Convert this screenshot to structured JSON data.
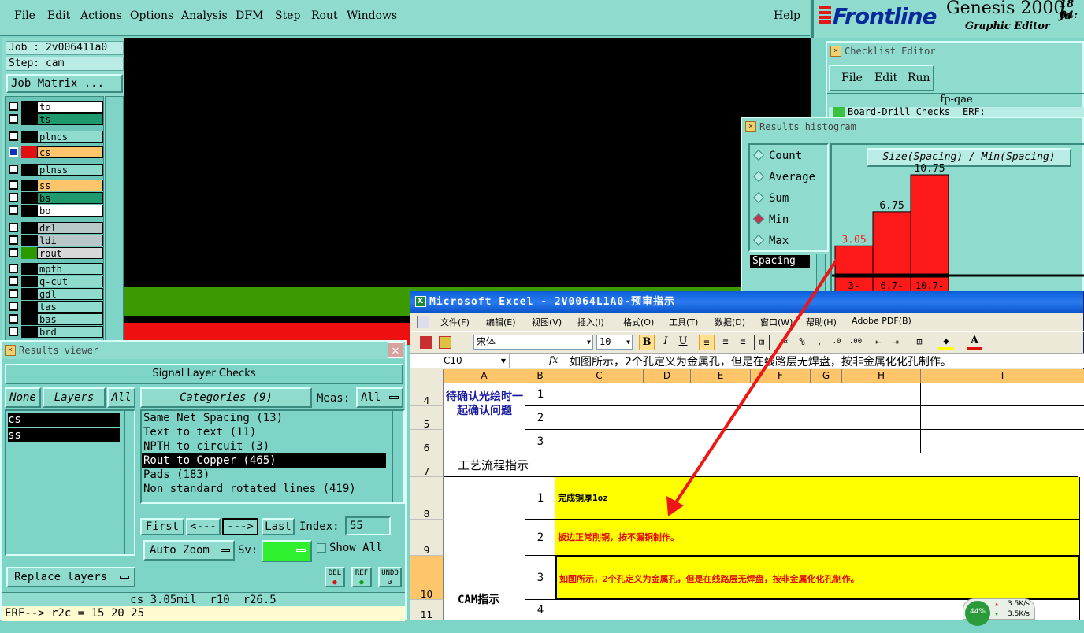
{
  "menubar": {
    "items": [
      "File",
      "Edit",
      "Actions",
      "Options",
      "Analysis",
      "DFM",
      "Step",
      "Rout",
      "Windows"
    ],
    "help": "Help"
  },
  "brand": {
    "logo": "Frontline",
    "product": "Genesis 2000",
    "subtitle": "Graphic Editor",
    "date": "18 Ja",
    "time": "04:"
  },
  "job": {
    "job_line": "Job : 2v006411a0",
    "step_line": "Step: cam",
    "matrix_button": "Job Matrix ..."
  },
  "layers": [
    {
      "name": "to",
      "color": "#ffffff"
    },
    {
      "name": "ts",
      "color": "#1f9a6e"
    },
    {
      "name": "plncs",
      "color": "#8fdccf"
    },
    {
      "name": "cs",
      "color": "#ffc56a",
      "active": true
    },
    {
      "name": "plnss",
      "color": "#8fdccf"
    },
    {
      "name": "ss",
      "color": "#ffc56a"
    },
    {
      "name": "bs",
      "color": "#1f9a6e"
    },
    {
      "name": "bo",
      "color": "#ffffff"
    },
    {
      "name": "drl",
      "color": "#b8c8c8"
    },
    {
      "name": "ldi",
      "color": "#b8c8c8"
    },
    {
      "name": "rout",
      "color": "#d8d8d8"
    },
    {
      "name": "mpth",
      "color": "#8fdccf"
    },
    {
      "name": "q-cut",
      "color": "#8fdccf"
    },
    {
      "name": "gdl",
      "color": "#8fdccf"
    },
    {
      "name": "tas",
      "color": "#8fdccf"
    },
    {
      "name": "bas",
      "color": "#8fdccf"
    },
    {
      "name": "brd",
      "color": "#8fdccf"
    }
  ],
  "results_viewer": {
    "title": "Results viewer",
    "header": "Signal Layer Checks",
    "none": "None",
    "layers": "Layers",
    "all": "All",
    "layer_list": [
      "cs",
      "ss"
    ],
    "categories_label": "Categories (9)",
    "meas_label": "Meas:",
    "meas_value": "All",
    "categories": [
      "Same Net Spacing (13)",
      "Text to text (11)",
      "NPTH to circuit (3)",
      "Rout to Copper (465)",
      "Pads (183)",
      "Non standard rotated lines (419)"
    ],
    "selected_category": 3,
    "first": "First",
    "prev": "<---",
    "next": "--->",
    "last": "Last",
    "index_label": "Index:",
    "index_value": "55",
    "auto_zoom": "Auto Zoom",
    "sv_label": "Sv:",
    "show_all": "Show All",
    "replace_layers": "Replace layers",
    "del": "DEL",
    "ref": "REF",
    "undo": "UNDO",
    "status": "cs 3.05mil  r10  r26.5",
    "erf": "ERF--> r2c = 15 20 25"
  },
  "checklist": {
    "title": "Checklist Editor",
    "menu": [
      "File",
      "Edit",
      "Run"
    ],
    "name": "fp-qae",
    "row": "Board-Drill Checks",
    "row2": "ERF:"
  },
  "histogram": {
    "title": "Results histogram",
    "options": [
      "Count",
      "Average",
      "Sum",
      "Min",
      "Max"
    ],
    "selected": "Min",
    "spacing": "Spacing",
    "chart_title": "Size(Spacing) / Min(Spacing)",
    "chart_data": {
      "type": "bar",
      "categories": [
        "3-",
        "6.7-",
        "10.7-"
      ],
      "values": [
        3.05,
        6.75,
        10.75
      ],
      "value_labels": [
        "3.05",
        "6.75",
        "10.75"
      ],
      "title": "Size(Spacing) / Min(Spacing)",
      "ylim": [
        0,
        10.75
      ]
    }
  },
  "excel": {
    "title": "Microsoft Excel - 2V0064L1A0-预审指示",
    "menu": [
      "文件(F)",
      "编辑(E)",
      "视图(V)",
      "插入(I)",
      "格式(O)",
      "工具(T)",
      "数据(D)",
      "窗口(W)",
      "帮助(H)",
      "Adobe PDF(B)"
    ],
    "font": "宋体",
    "size": "10",
    "cell_ref": "C10",
    "fx": "fx",
    "formula": "如图所示，2个孔定义为金属孔，但是在线路层无焊盘，按非金属化化孔制作。",
    "columns": [
      "A",
      "B",
      "C",
      "D",
      "E",
      "F",
      "G",
      "H",
      "I"
    ],
    "rows": [
      "4",
      "5",
      "6",
      "7",
      "8",
      "9",
      "10",
      "11"
    ],
    "confirm": "待确认光绘时一起确认问题",
    "process": "工艺流程指示",
    "cam": "CAM指示",
    "nums": [
      "1",
      "2",
      "3",
      "1",
      "2",
      "3",
      "4"
    ],
    "instr": [
      "完成铜厚1oz",
      "板边正常削铜，按不漏铜制作。",
      "如图所示，2个孔定义为金属孔，但是在线路层无焊盘，按非金属化化孔制作。"
    ]
  },
  "net": {
    "pct": "44%",
    "up": "3.5K/s",
    "down": "3.5K/s"
  }
}
